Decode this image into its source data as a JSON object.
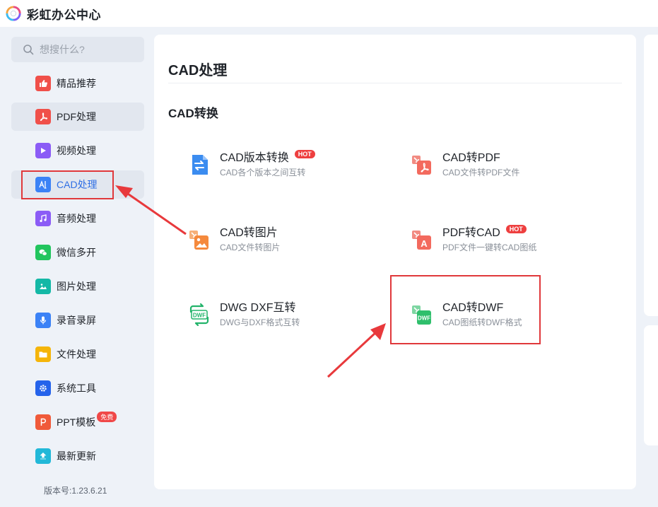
{
  "app": {
    "title": "彩虹办公中心"
  },
  "sidebar": {
    "search_placeholder": "想搜什么?",
    "items": [
      {
        "label": "精品推荐",
        "icon": "thumbs-up-icon",
        "color": "#f0504a"
      },
      {
        "label": "PDF处理",
        "icon": "pdf-icon",
        "color": "#f0504a"
      },
      {
        "label": "视频处理",
        "icon": "play-icon",
        "color": "#8b5cf6"
      },
      {
        "label": "CAD处理",
        "icon": "cad-icon",
        "color": "#3b82f6",
        "active": true
      },
      {
        "label": "音频处理",
        "icon": "music-icon",
        "color": "#8b5cf6"
      },
      {
        "label": "微信多开",
        "icon": "wechat-icon",
        "color": "#22c55e"
      },
      {
        "label": "图片处理",
        "icon": "image-icon",
        "color": "#14b8a6"
      },
      {
        "label": "录音录屏",
        "icon": "microphone-icon",
        "color": "#3b82f6"
      },
      {
        "label": "文件处理",
        "icon": "folder-icon",
        "color": "#f5b50a"
      },
      {
        "label": "系统工具",
        "icon": "gear-icon",
        "color": "#2563eb"
      },
      {
        "label": "PPT模板",
        "icon": "ppt-icon",
        "color": "#f05a3a",
        "badge": "免费"
      },
      {
        "label": "最新更新",
        "icon": "upload-icon",
        "color": "#22b8d8"
      }
    ],
    "version": "版本号:1.23.6.21"
  },
  "main": {
    "title": "CAD处理",
    "section": "CAD转换",
    "hot_label": "HOT",
    "tools": [
      {
        "name": "CAD版本转换",
        "desc": "CAD各个版本之间互转",
        "hot": true,
        "icon": "version-convert-icon"
      },
      {
        "name": "CAD转PDF",
        "desc": "CAD文件转PDF文件",
        "hot": false,
        "icon": "cad-to-pdf-icon"
      },
      {
        "name": "CAD转图片",
        "desc": "CAD文件转图片",
        "hot": false,
        "icon": "cad-to-image-icon"
      },
      {
        "name": "PDF转CAD",
        "desc": "PDF文件一键转CAD图纸",
        "hot": true,
        "icon": "pdf-to-cad-icon"
      },
      {
        "name": "DWG DXF互转",
        "desc": "DWG与DXF格式互转",
        "hot": false,
        "icon": "dwg-dxf-icon"
      },
      {
        "name": "CAD转DWF",
        "desc": "CAD图纸转DWF格式",
        "hot": false,
        "icon": "cad-to-dwf-icon"
      }
    ],
    "icon_text": {
      "dwf": "DWF",
      "a": "A"
    }
  },
  "colors": {
    "accent": "#2f6fe4",
    "annotation": "#e0383b",
    "hot": "#ee3f3f"
  }
}
